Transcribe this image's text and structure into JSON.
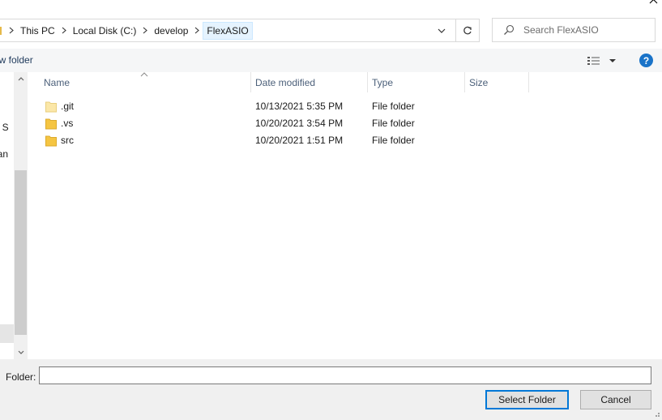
{
  "address_bar": {
    "crumbs": [
      "This PC",
      "Local Disk (C:)",
      "develop",
      "FlexASIO"
    ],
    "dropdown_icon": "chevron-down-icon",
    "refresh_icon": "refresh-icon"
  },
  "search": {
    "placeholder": "Search FlexASIO",
    "icon": "search-icon"
  },
  "toolbar": {
    "new_folder_label": "ew folder",
    "view_icon": "view-options-icon",
    "help_label": "?"
  },
  "nav_pane": {
    "fragments": [
      "al S",
      "gan",
      ")"
    ]
  },
  "file_list": {
    "columns": [
      "Name",
      "Date modified",
      "Type",
      "Size"
    ],
    "rows": [
      {
        "name": ".git",
        "date": "10/13/2021 5:35 PM",
        "type": "File folder",
        "size": ""
      },
      {
        "name": ".vs",
        "date": "10/20/2021 3:54 PM",
        "type": "File folder",
        "size": ""
      },
      {
        "name": "src",
        "date": "10/20/2021 1:51 PM",
        "type": "File folder",
        "size": ""
      }
    ]
  },
  "bottom": {
    "folder_label": "Folder:",
    "folder_value": "",
    "select_label": "Select Folder",
    "cancel_label": "Cancel"
  },
  "colors": {
    "accent": "#0078d7",
    "folder": "#f5c542",
    "header_text": "#4c607a",
    "help": "#1a73c8"
  }
}
